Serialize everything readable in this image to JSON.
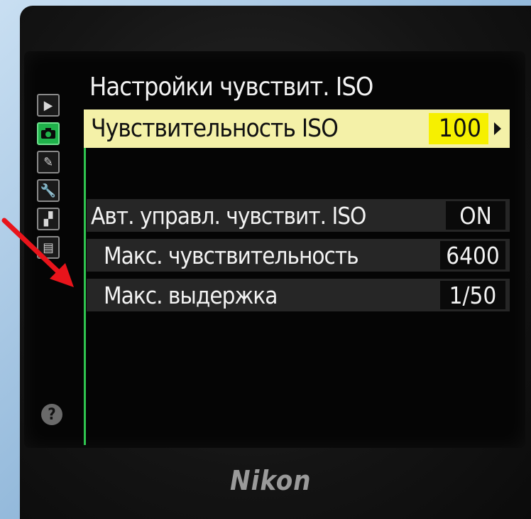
{
  "screen": {
    "title": "Настройки чувствит. ISO",
    "selected_item": {
      "label": "Чувствительность ISO",
      "value": "100"
    },
    "items": [
      {
        "label": "Авт. управл. чувствит. ISO",
        "value": "ON"
      },
      {
        "label": "Макс. чувствительность",
        "value": "6400"
      },
      {
        "label": "Макс. выдержка",
        "value": "1/50"
      }
    ]
  },
  "sidebar": {
    "icons": [
      "playback-icon",
      "camera-icon",
      "pencil-icon",
      "wrench-icon",
      "retouch-icon",
      "my-menu-icon"
    ],
    "active_index": 1,
    "help": "?"
  },
  "brand": "Nikon",
  "colors": {
    "highlight": "#f4f1a8",
    "value_highlight": "#f6f000",
    "accent": "#2fc44f",
    "annotation": "#e8141b"
  }
}
